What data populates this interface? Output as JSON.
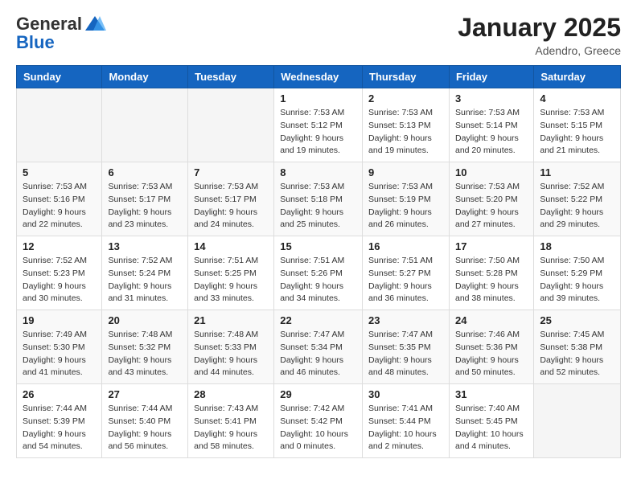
{
  "header": {
    "logo_general": "General",
    "logo_blue": "Blue",
    "month": "January 2025",
    "location": "Adendro, Greece"
  },
  "days_of_week": [
    "Sunday",
    "Monday",
    "Tuesday",
    "Wednesday",
    "Thursday",
    "Friday",
    "Saturday"
  ],
  "weeks": [
    [
      {
        "day": "",
        "info": ""
      },
      {
        "day": "",
        "info": ""
      },
      {
        "day": "",
        "info": ""
      },
      {
        "day": "1",
        "info": "Sunrise: 7:53 AM\nSunset: 5:12 PM\nDaylight: 9 hours\nand 19 minutes."
      },
      {
        "day": "2",
        "info": "Sunrise: 7:53 AM\nSunset: 5:13 PM\nDaylight: 9 hours\nand 19 minutes."
      },
      {
        "day": "3",
        "info": "Sunrise: 7:53 AM\nSunset: 5:14 PM\nDaylight: 9 hours\nand 20 minutes."
      },
      {
        "day": "4",
        "info": "Sunrise: 7:53 AM\nSunset: 5:15 PM\nDaylight: 9 hours\nand 21 minutes."
      }
    ],
    [
      {
        "day": "5",
        "info": "Sunrise: 7:53 AM\nSunset: 5:16 PM\nDaylight: 9 hours\nand 22 minutes."
      },
      {
        "day": "6",
        "info": "Sunrise: 7:53 AM\nSunset: 5:17 PM\nDaylight: 9 hours\nand 23 minutes."
      },
      {
        "day": "7",
        "info": "Sunrise: 7:53 AM\nSunset: 5:17 PM\nDaylight: 9 hours\nand 24 minutes."
      },
      {
        "day": "8",
        "info": "Sunrise: 7:53 AM\nSunset: 5:18 PM\nDaylight: 9 hours\nand 25 minutes."
      },
      {
        "day": "9",
        "info": "Sunrise: 7:53 AM\nSunset: 5:19 PM\nDaylight: 9 hours\nand 26 minutes."
      },
      {
        "day": "10",
        "info": "Sunrise: 7:53 AM\nSunset: 5:20 PM\nDaylight: 9 hours\nand 27 minutes."
      },
      {
        "day": "11",
        "info": "Sunrise: 7:52 AM\nSunset: 5:22 PM\nDaylight: 9 hours\nand 29 minutes."
      }
    ],
    [
      {
        "day": "12",
        "info": "Sunrise: 7:52 AM\nSunset: 5:23 PM\nDaylight: 9 hours\nand 30 minutes."
      },
      {
        "day": "13",
        "info": "Sunrise: 7:52 AM\nSunset: 5:24 PM\nDaylight: 9 hours\nand 31 minutes."
      },
      {
        "day": "14",
        "info": "Sunrise: 7:51 AM\nSunset: 5:25 PM\nDaylight: 9 hours\nand 33 minutes."
      },
      {
        "day": "15",
        "info": "Sunrise: 7:51 AM\nSunset: 5:26 PM\nDaylight: 9 hours\nand 34 minutes."
      },
      {
        "day": "16",
        "info": "Sunrise: 7:51 AM\nSunset: 5:27 PM\nDaylight: 9 hours\nand 36 minutes."
      },
      {
        "day": "17",
        "info": "Sunrise: 7:50 AM\nSunset: 5:28 PM\nDaylight: 9 hours\nand 38 minutes."
      },
      {
        "day": "18",
        "info": "Sunrise: 7:50 AM\nSunset: 5:29 PM\nDaylight: 9 hours\nand 39 minutes."
      }
    ],
    [
      {
        "day": "19",
        "info": "Sunrise: 7:49 AM\nSunset: 5:30 PM\nDaylight: 9 hours\nand 41 minutes."
      },
      {
        "day": "20",
        "info": "Sunrise: 7:48 AM\nSunset: 5:32 PM\nDaylight: 9 hours\nand 43 minutes."
      },
      {
        "day": "21",
        "info": "Sunrise: 7:48 AM\nSunset: 5:33 PM\nDaylight: 9 hours\nand 44 minutes."
      },
      {
        "day": "22",
        "info": "Sunrise: 7:47 AM\nSunset: 5:34 PM\nDaylight: 9 hours\nand 46 minutes."
      },
      {
        "day": "23",
        "info": "Sunrise: 7:47 AM\nSunset: 5:35 PM\nDaylight: 9 hours\nand 48 minutes."
      },
      {
        "day": "24",
        "info": "Sunrise: 7:46 AM\nSunset: 5:36 PM\nDaylight: 9 hours\nand 50 minutes."
      },
      {
        "day": "25",
        "info": "Sunrise: 7:45 AM\nSunset: 5:38 PM\nDaylight: 9 hours\nand 52 minutes."
      }
    ],
    [
      {
        "day": "26",
        "info": "Sunrise: 7:44 AM\nSunset: 5:39 PM\nDaylight: 9 hours\nand 54 minutes."
      },
      {
        "day": "27",
        "info": "Sunrise: 7:44 AM\nSunset: 5:40 PM\nDaylight: 9 hours\nand 56 minutes."
      },
      {
        "day": "28",
        "info": "Sunrise: 7:43 AM\nSunset: 5:41 PM\nDaylight: 9 hours\nand 58 minutes."
      },
      {
        "day": "29",
        "info": "Sunrise: 7:42 AM\nSunset: 5:42 PM\nDaylight: 10 hours\nand 0 minutes."
      },
      {
        "day": "30",
        "info": "Sunrise: 7:41 AM\nSunset: 5:44 PM\nDaylight: 10 hours\nand 2 minutes."
      },
      {
        "day": "31",
        "info": "Sunrise: 7:40 AM\nSunset: 5:45 PM\nDaylight: 10 hours\nand 4 minutes."
      },
      {
        "day": "",
        "info": ""
      }
    ]
  ]
}
